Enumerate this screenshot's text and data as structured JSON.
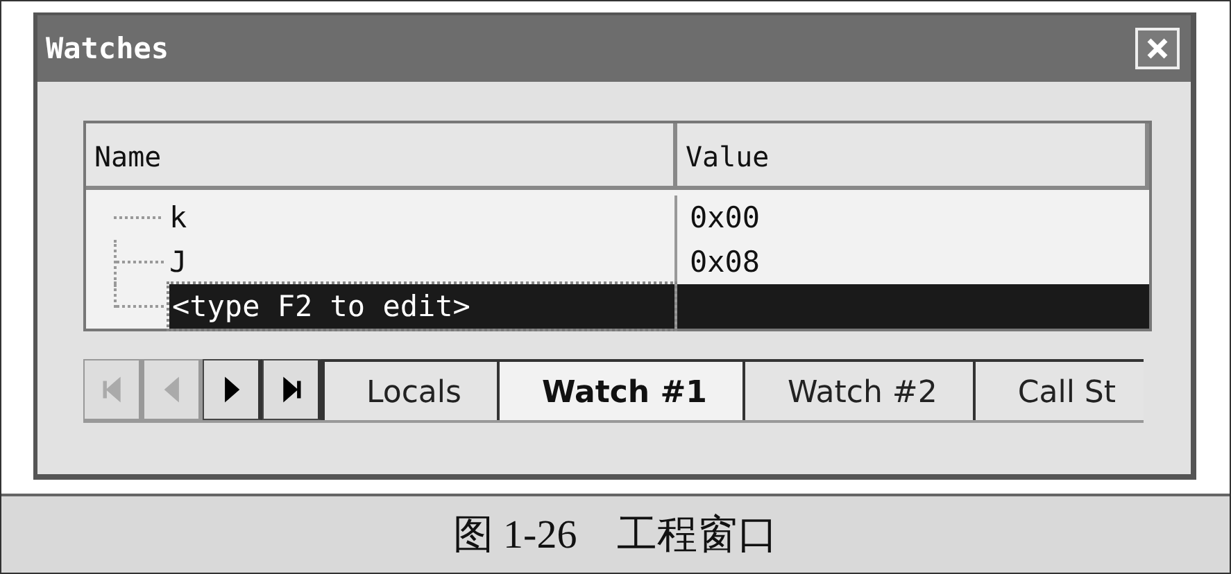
{
  "window": {
    "title": "Watches"
  },
  "columns": [
    "Name",
    "Value"
  ],
  "rows": [
    {
      "name": "k",
      "value": "0x00",
      "selected": false
    },
    {
      "name": "J",
      "value": "0x08",
      "selected": false
    },
    {
      "name": "<type F2 to edit>",
      "value": "",
      "selected": true
    }
  ],
  "nav_buttons": [
    {
      "kind": "first",
      "disabled": true
    },
    {
      "kind": "prev",
      "disabled": true
    },
    {
      "kind": "next",
      "disabled": false
    },
    {
      "kind": "last",
      "disabled": false
    }
  ],
  "tabs": [
    {
      "label": "Locals",
      "selected": false
    },
    {
      "label": "Watch #1",
      "selected": true
    },
    {
      "label": "Watch #2",
      "selected": false
    },
    {
      "label": "Call St",
      "selected": false
    }
  ],
  "caption": "图 1-26　工程窗口"
}
